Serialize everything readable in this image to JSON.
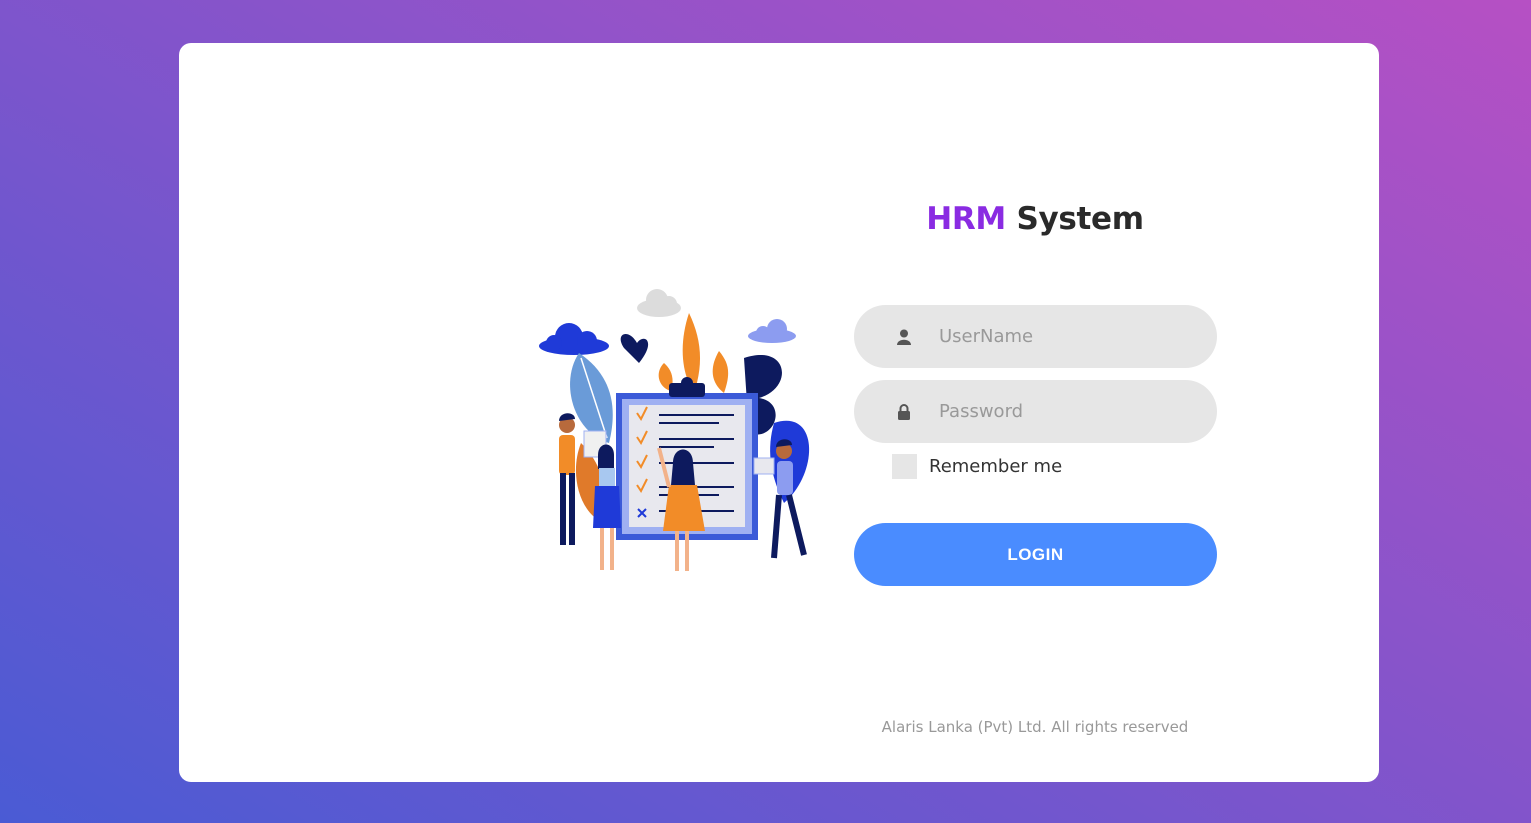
{
  "brand": {
    "accent_word": "HRM",
    "rest_word": "System",
    "accent_color": "#8a2be2"
  },
  "form": {
    "username": {
      "placeholder": "UserName",
      "value": "",
      "icon": "user-icon"
    },
    "password": {
      "placeholder": "Password",
      "value": "",
      "icon": "lock-icon"
    },
    "remember_label": "Remember me",
    "remember_checked": false,
    "login_label": "LOGIN",
    "login_color": "#4a8cff"
  },
  "footer": {
    "text": "Alaris Lanka (Pvt) Ltd. All rights reserved"
  },
  "illustration": {
    "icon": "team-checklist-illustration"
  }
}
